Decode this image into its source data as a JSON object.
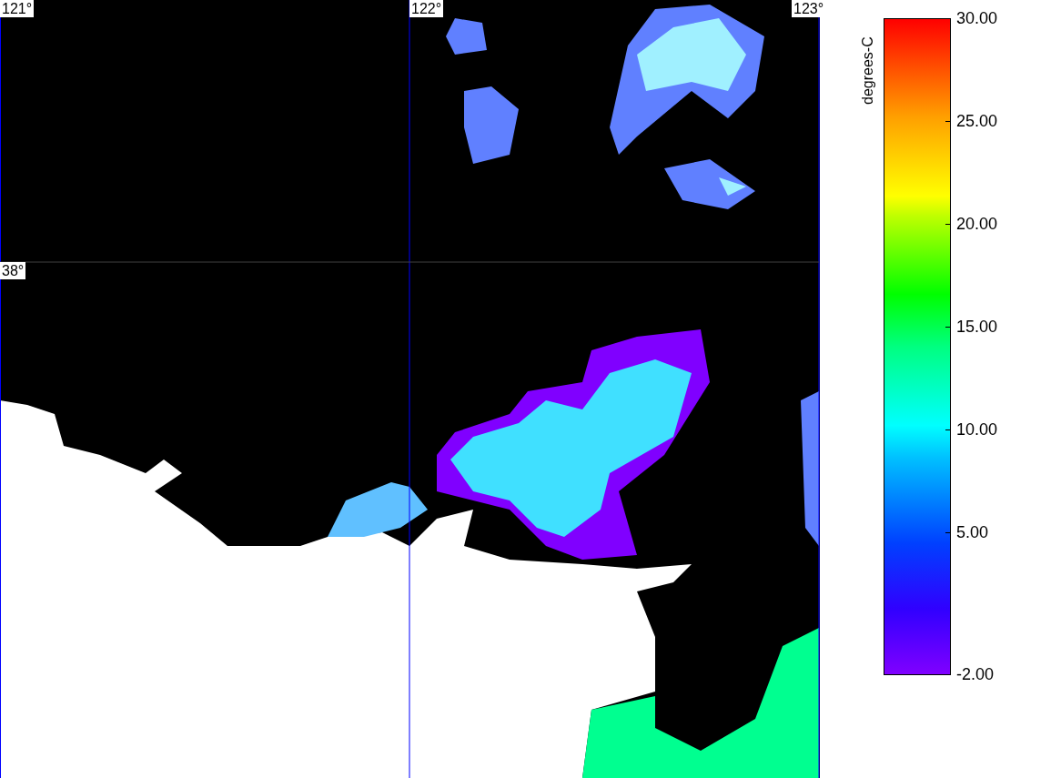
{
  "map": {
    "grid_labels": [
      {
        "kind": "lon",
        "text": "121°"
      },
      {
        "kind": "lon",
        "text": "122°"
      },
      {
        "kind": "lon",
        "text": "123°"
      },
      {
        "kind": "lat",
        "text": "38°"
      }
    ]
  },
  "legend": {
    "unit": "degrees-C",
    "ticks": [
      "30.00",
      "25.00",
      "20.00",
      "15.00",
      "10.00",
      "5.00",
      "-2.00"
    ]
  }
}
